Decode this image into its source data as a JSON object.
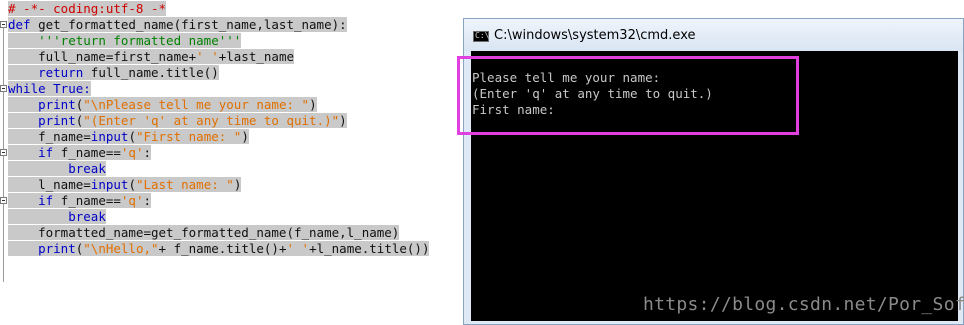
{
  "editor": {
    "lines": [
      {
        "segments": [
          {
            "t": "# -*- coding:utf-8 -*",
            "c": "cmt"
          }
        ]
      },
      {
        "segments": [
          {
            "t": "def ",
            "c": "kw"
          },
          {
            "t": "get_formatted_name(first_name,last_name):",
            "c": "plain"
          }
        ]
      },
      {
        "segments": [
          {
            "t": "    ",
            "c": "plain"
          },
          {
            "t": "'''return formatted name'''",
            "c": "doc"
          }
        ]
      },
      {
        "segments": [
          {
            "t": "    full_name=first_name+",
            "c": "plain"
          },
          {
            "t": "' '",
            "c": "str"
          },
          {
            "t": "+last_name",
            "c": "plain"
          }
        ]
      },
      {
        "segments": [
          {
            "t": "    ",
            "c": "plain"
          },
          {
            "t": "return",
            "c": "kw"
          },
          {
            "t": " full_name.title()",
            "c": "plain"
          }
        ]
      },
      {
        "segments": [
          {
            "t": "while True:",
            "c": "kw"
          }
        ]
      },
      {
        "segments": [
          {
            "t": "    ",
            "c": "plain"
          },
          {
            "t": "print",
            "c": "kw"
          },
          {
            "t": "(",
            "c": "plain"
          },
          {
            "t": "\"\\nPlease tell me your name: \"",
            "c": "str"
          },
          {
            "t": ")",
            "c": "plain"
          }
        ]
      },
      {
        "segments": [
          {
            "t": "    ",
            "c": "plain"
          },
          {
            "t": "print",
            "c": "kw"
          },
          {
            "t": "(",
            "c": "plain"
          },
          {
            "t": "\"(Enter 'q' at any time to quit.)\"",
            "c": "str"
          },
          {
            "t": ")",
            "c": "plain"
          }
        ]
      },
      {
        "segments": [
          {
            "t": "    f_name=",
            "c": "plain"
          },
          {
            "t": "input",
            "c": "kw"
          },
          {
            "t": "(",
            "c": "plain"
          },
          {
            "t": "\"First name: \"",
            "c": "str"
          },
          {
            "t": ")",
            "c": "plain"
          }
        ]
      },
      {
        "segments": [
          {
            "t": "    ",
            "c": "plain"
          },
          {
            "t": "if",
            "c": "kw"
          },
          {
            "t": " f_name==",
            "c": "plain"
          },
          {
            "t": "'q'",
            "c": "str"
          },
          {
            "t": ":",
            "c": "plain"
          }
        ]
      },
      {
        "segments": [
          {
            "t": "        ",
            "c": "plain"
          },
          {
            "t": "break",
            "c": "kw"
          }
        ]
      },
      {
        "segments": [
          {
            "t": "    l_name=",
            "c": "plain"
          },
          {
            "t": "input",
            "c": "kw"
          },
          {
            "t": "(",
            "c": "plain"
          },
          {
            "t": "\"Last name: \"",
            "c": "str"
          },
          {
            "t": ")",
            "c": "plain"
          }
        ]
      },
      {
        "segments": [
          {
            "t": "    ",
            "c": "plain"
          },
          {
            "t": "if",
            "c": "kw"
          },
          {
            "t": " f_name==",
            "c": "plain"
          },
          {
            "t": "'q'",
            "c": "str"
          },
          {
            "t": ":",
            "c": "plain"
          }
        ]
      },
      {
        "segments": [
          {
            "t": "        ",
            "c": "plain"
          },
          {
            "t": "break",
            "c": "kw"
          }
        ]
      },
      {
        "segments": [
          {
            "t": "    formatted_name=get_formatted_name(f_name,l_name)",
            "c": "plain"
          }
        ]
      },
      {
        "segments": [
          {
            "t": "    ",
            "c": "plain"
          },
          {
            "t": "print",
            "c": "kw"
          },
          {
            "t": "(",
            "c": "plain"
          },
          {
            "t": "\"\\nHello,\"",
            "c": "str"
          },
          {
            "t": "+ f_name.title()+",
            "c": "plain"
          },
          {
            "t": "' '",
            "c": "str"
          },
          {
            "t": "+l_name.title())",
            "c": "plain"
          }
        ]
      }
    ]
  },
  "cmd": {
    "title": "C:\\windows\\system32\\cmd.exe",
    "icon_text": "C:\\",
    "output": [
      "Please tell me your name:",
      "(Enter 'q' at any time to quit.)",
      "First name:"
    ]
  },
  "watermark": "https://blog.csdn.net/Por_Sofia",
  "colors": {
    "keyword": "#0000c8",
    "string": "#e07000",
    "comment": "#d00000",
    "docstring": "#008000",
    "selection": "#c9c9c9",
    "highlight_box": "#e040e0",
    "console_bg": "#000000",
    "console_fg": "#c8c8c8"
  }
}
